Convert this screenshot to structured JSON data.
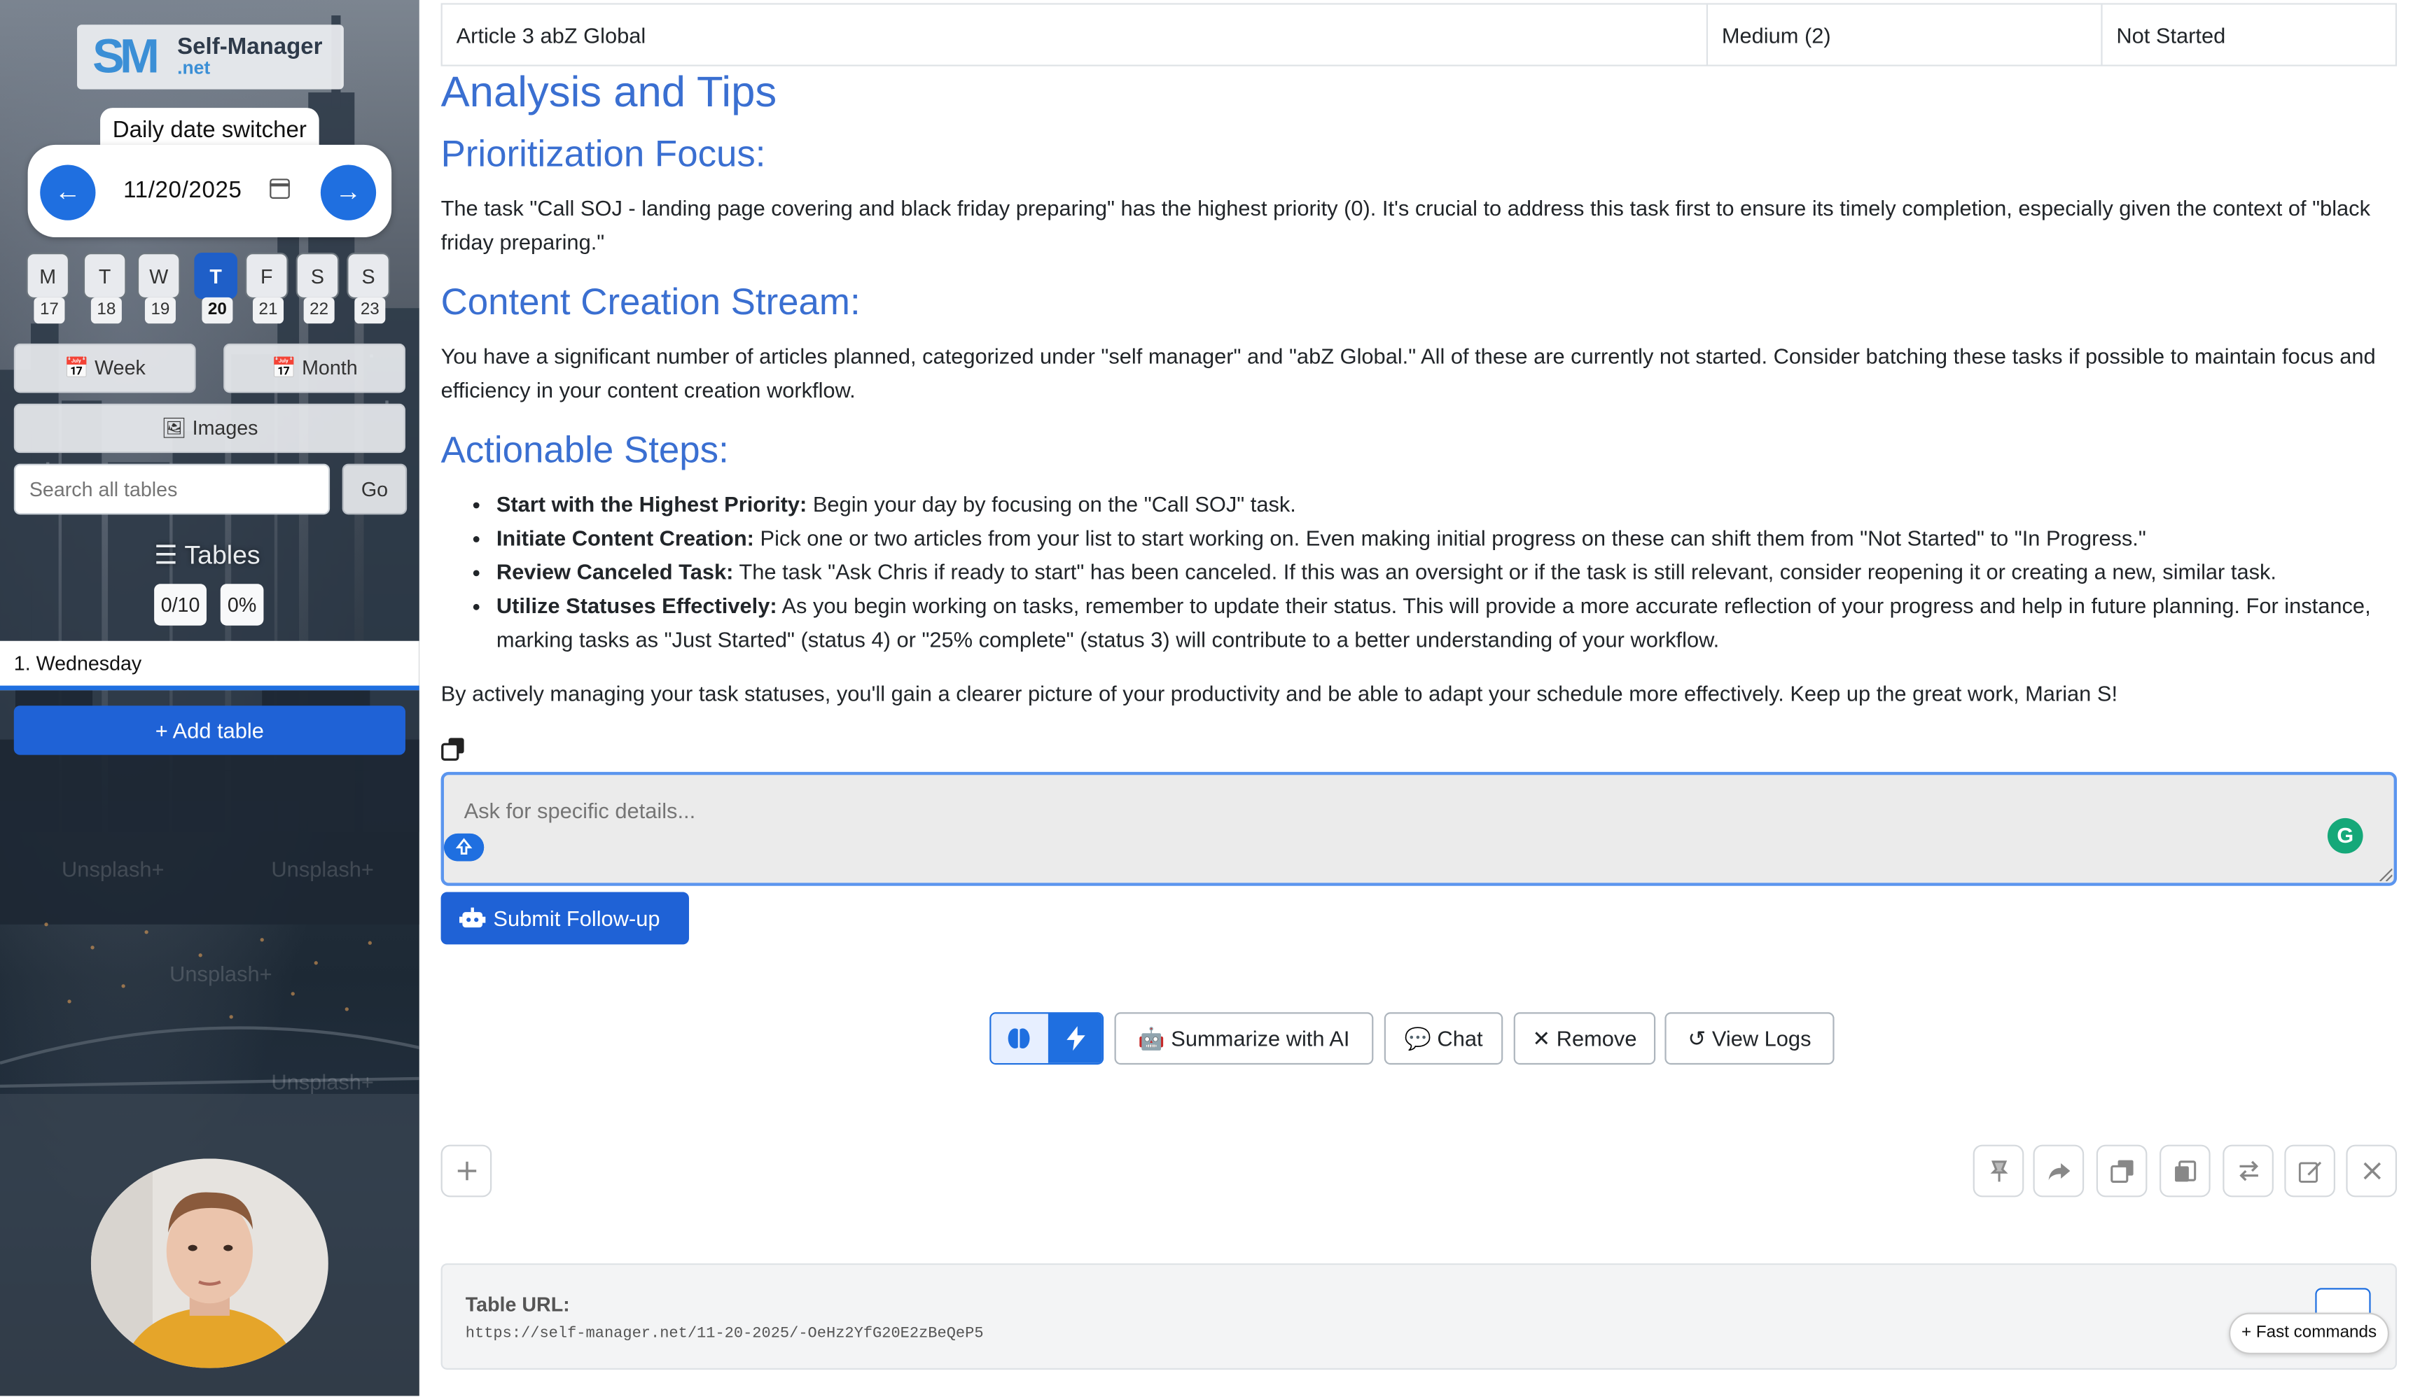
{
  "app": {
    "logo_text": "Self-Manager",
    "logo_sub": ".net",
    "logo_mark": "SM"
  },
  "date_switcher": {
    "label": "Daily date switcher",
    "date": "11/20/2025",
    "prev_icon": "arrow-left-icon",
    "next_icon": "arrow-right-icon"
  },
  "week_days": [
    {
      "letter": "M",
      "day": "17"
    },
    {
      "letter": "T",
      "day": "18"
    },
    {
      "letter": "W",
      "day": "19"
    },
    {
      "letter": "T",
      "day": "20",
      "active": true
    },
    {
      "letter": "F",
      "day": "21"
    },
    {
      "letter": "S",
      "day": "22"
    },
    {
      "letter": "S",
      "day": "23"
    }
  ],
  "sidebar": {
    "week_label": "Week",
    "month_label": "Month",
    "images_label": "Images",
    "search_placeholder": "Search all tables",
    "go_label": "Go",
    "tables_title": "Tables",
    "tasks_count": "0/10",
    "progress": "0%",
    "day_item": "1. Wednesday",
    "add_table_label": "Add table",
    "watermark": "Unsplash+"
  },
  "task_row": {
    "name": "Article 3 abZ Global",
    "priority": "Medium (2)",
    "status": "Not Started"
  },
  "analysis": {
    "title": "Analysis and Tips",
    "prioritization_heading": "Prioritization Focus:",
    "prioritization_text": "The task \"Call SOJ - landing page covering and black friday preparing\" has the highest priority (0). It's crucial to address this task first to ensure its timely completion, especially given the context of \"black friday preparing.\"",
    "content_heading": "Content Creation Stream:",
    "content_text": "You have a significant number of articles planned, categorized under \"self manager\" and \"abZ Global.\" All of these are currently not started. Consider batching these tasks if possible to maintain focus and efficiency in your content creation workflow.",
    "steps_heading": "Actionable Steps:",
    "steps": [
      {
        "title": "Start with the Highest Priority:",
        "text": " Begin your day by focusing on the \"Call SOJ\" task."
      },
      {
        "title": "Initiate Content Creation:",
        "text": " Pick one or two articles from your list to start working on. Even making initial progress on these can shift them from \"Not Started\" to \"In Progress.\""
      },
      {
        "title": "Review Canceled Task:",
        "text": " The task \"Ask Chris if ready to start\" has been canceled. If this was an oversight or if the task is still relevant, consider reopening it or creating a new, similar task."
      },
      {
        "title": "Utilize Statuses Effectively:",
        "text": " As you begin working on tasks, remember to update their status. This will provide a more accurate reflection of your progress and help in future planning. For instance, marking tasks as \"Just Started\" (status 4) or \"25% complete\" (status 3) will contribute to a better understanding of your workflow."
      }
    ],
    "closing_text": "By actively managing your task statuses, you'll gain a clearer picture of your productivity and be able to adapt your schedule more effectively. Keep up the great work, Marian S!"
  },
  "followup": {
    "placeholder": "Ask for specific details...",
    "submit_label": "Submit Follow-up",
    "grammarly_letter": "G"
  },
  "actions": {
    "summarize_label": "Summarize with AI",
    "chat_label": "Chat",
    "remove_label": "Remove",
    "logs_label": "View Logs"
  },
  "table_url": {
    "label": "Table URL:",
    "value": "https://self-manager.net/11-20-2025/-OeHz2YfG20E2zBeQeP5"
  },
  "fast_commands_label": "+ Fast commands",
  "colors": {
    "accent": "#1f62d6",
    "heading": "#3a6fd1"
  }
}
